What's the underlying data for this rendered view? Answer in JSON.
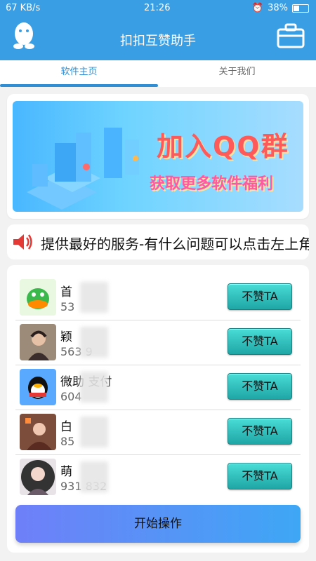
{
  "status": {
    "network": "67 KB/s",
    "time": "21:26",
    "battery": "38%"
  },
  "header": {
    "title": "扣扣互赞助手"
  },
  "tabs": [
    {
      "label": "软件主页"
    },
    {
      "label": "关于我们"
    }
  ],
  "banner": {
    "line1": "加入QQ群",
    "line2": "获取更多软件福利"
  },
  "marquee": {
    "text": "提供最好的服务-有什么问题可以点击左上角联系"
  },
  "users": [
    {
      "name": "首",
      "number": "53",
      "button": "不赞TA"
    },
    {
      "name": "颖",
      "number": "563  9",
      "button": "不赞TA"
    },
    {
      "name": "微助    支付",
      "number": "604",
      "button": "不赞TA"
    },
    {
      "name": "白",
      "number": "85",
      "button": "不赞TA"
    },
    {
      "name": "萌",
      "number": "931  832",
      "button": "不赞TA"
    }
  ],
  "actions": {
    "start": "开始操作"
  },
  "colors": {
    "primary": "#3a9ee4",
    "tab_active": "#2f8fd6",
    "button_teal": "#28b7b5"
  }
}
